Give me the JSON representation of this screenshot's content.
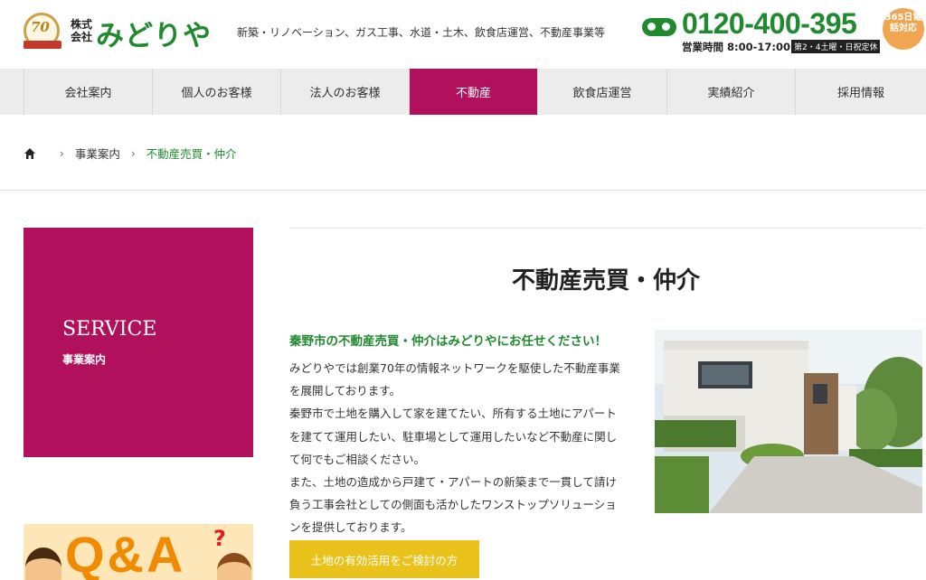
{
  "header": {
    "logo_badge": "70",
    "company_prefix": "株式会社",
    "brand_name": "みどりや",
    "tagline": "新築・リノベーション、ガス工事、水道・土木、飲食店運営、不動産事業等",
    "phone": "0120-400-395",
    "hours": "営業時間 8:00-17:00",
    "holiday": "第2・4土曜・日祝定休",
    "badge_365": "365日電話対応"
  },
  "nav": {
    "items": [
      {
        "label": "会社案内"
      },
      {
        "label": "個人のお客様"
      },
      {
        "label": "法人のお客様"
      },
      {
        "label": "不動産"
      },
      {
        "label": "飲食店運営"
      },
      {
        "label": "実績紹介"
      },
      {
        "label": "採用情報"
      }
    ],
    "active_index": 3
  },
  "breadcrumb": {
    "parent": "事業案内",
    "current": "不動産売買・仲介"
  },
  "sidebar": {
    "service_title": "SERVICE",
    "service_sub": "事業案内",
    "qa_text": "Q&A",
    "qa_mark": "?"
  },
  "main": {
    "title": "不動産売買・仲介",
    "lead": "秦野市の不動産売買・仲介はみどりやにお任せください！",
    "paragraph_lines": [
      "みどりやでは創業70年の情報ネットワークを駆使した不動産事業",
      "を展開しております。",
      "秦野市で土地を購入して家を建てたい、所有する土地にアパート",
      "を建てて運用したい、駐車場として運用したいなど不動産に関し",
      "て何でもご相談ください。",
      "また、土地の造成から戸建て・アパートの新築まで一貫して請け",
      "負う工事会社としての側面も活かしたワンストップソリューショ",
      "ンを提供しております。"
    ],
    "cta_label": "土地の有効活用をご検討の方"
  },
  "colors": {
    "brand_green": "#1f8a2e",
    "accent_magenta": "#b1115c",
    "cta_yellow": "#e9c31b",
    "qa_orange": "#f08a00"
  }
}
